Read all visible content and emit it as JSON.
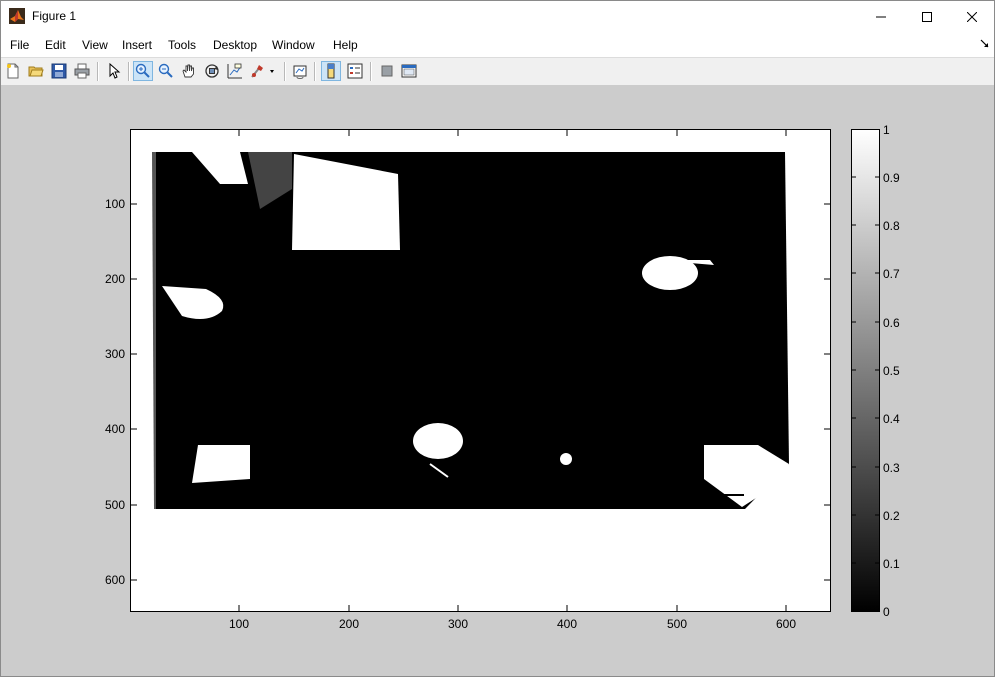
{
  "window": {
    "title": "Figure 1"
  },
  "menu": [
    "File",
    "Edit",
    "View",
    "Insert",
    "Tools",
    "Desktop",
    "Window",
    "Help"
  ],
  "toolbar": {
    "buttons": [
      {
        "name": "new-figure-icon"
      },
      {
        "name": "open-file-icon"
      },
      {
        "name": "save-figure-icon"
      },
      {
        "name": "print-figure-icon"
      },
      {
        "name": "edit-plot-arrow-icon"
      },
      {
        "name": "zoom-in-icon",
        "active": true
      },
      {
        "name": "zoom-out-icon"
      },
      {
        "name": "pan-hand-icon"
      },
      {
        "name": "rotate-3d-icon"
      },
      {
        "name": "data-cursor-icon"
      },
      {
        "name": "brush-icon"
      },
      {
        "name": "link-plot-icon"
      },
      {
        "name": "insert-colorbar-icon",
        "active": true
      },
      {
        "name": "insert-legend-icon"
      },
      {
        "name": "hide-plot-tools-icon"
      },
      {
        "name": "show-plot-tools-icon"
      }
    ]
  },
  "axes": {
    "x_ticks": [
      "100",
      "200",
      "300",
      "400",
      "500",
      "600"
    ],
    "y_ticks": [
      "100",
      "200",
      "300",
      "400",
      "500",
      "600"
    ]
  },
  "colorbar": {
    "ticks": [
      "1",
      "0.9",
      "0.8",
      "0.7",
      "0.6",
      "0.5",
      "0.4",
      "0.3",
      "0.2",
      "0.1",
      "0"
    ]
  },
  "colors": {
    "figure_bg": "#cccccc",
    "image_fg": "#000000",
    "image_bg": "#ffffff"
  }
}
